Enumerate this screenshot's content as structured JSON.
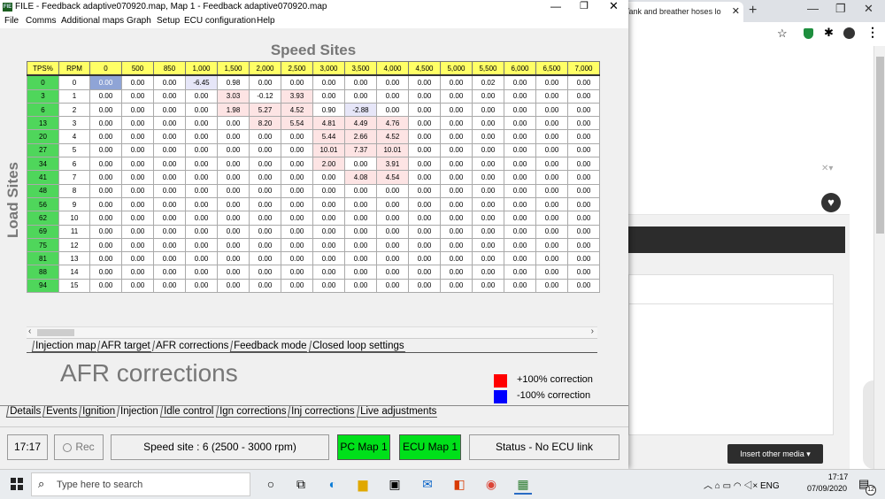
{
  "window": {
    "title": "FILE - Feedback adaptive070920.map,  Map 1 - Feedback adaptive070920.map",
    "icon_label": "FIE",
    "min": "—",
    "max": "❐",
    "close": "✕"
  },
  "menu": [
    "File",
    "Comms",
    "Additional maps",
    "Graph",
    "Setup",
    "ECU configuration",
    "Help"
  ],
  "grid": {
    "title": "Speed Sites",
    "side_title": "Load Sites",
    "header_tps": "TPS%",
    "header_rpm": "RPM",
    "columns": [
      "0",
      "500",
      "850",
      "1,000",
      "1,500",
      "2,000",
      "2,500",
      "3,000",
      "3,500",
      "4,000",
      "4,500",
      "5,000",
      "5,500",
      "6,000",
      "6,500",
      "7,000"
    ],
    "rows": [
      {
        "tps": "0",
        "idx": "0",
        "values": [
          "0.00",
          "0.00",
          "0.00",
          "-6.45",
          "0.98",
          "0.00",
          "0.00",
          "0.00",
          "0.00",
          "0.00",
          "0.00",
          "0.00",
          "0.02",
          "0.00",
          "0.00",
          "0.00"
        ]
      },
      {
        "tps": "3",
        "idx": "1",
        "values": [
          "0.00",
          "0.00",
          "0.00",
          "0.00",
          "3.03",
          "-0.12",
          "3.93",
          "0.00",
          "0.00",
          "0.00",
          "0.00",
          "0.00",
          "0.00",
          "0.00",
          "0.00",
          "0.00"
        ]
      },
      {
        "tps": "6",
        "idx": "2",
        "values": [
          "0.00",
          "0.00",
          "0.00",
          "0.00",
          "1.98",
          "5.27",
          "4.52",
          "0.90",
          "-2.88",
          "0.00",
          "0.00",
          "0.00",
          "0.00",
          "0.00",
          "0.00",
          "0.00"
        ]
      },
      {
        "tps": "13",
        "idx": "3",
        "values": [
          "0.00",
          "0.00",
          "0.00",
          "0.00",
          "0.00",
          "8.20",
          "5.54",
          "4.81",
          "4.49",
          "4.76",
          "0.00",
          "0.00",
          "0.00",
          "0.00",
          "0.00",
          "0.00"
        ]
      },
      {
        "tps": "20",
        "idx": "4",
        "values": [
          "0.00",
          "0.00",
          "0.00",
          "0.00",
          "0.00",
          "0.00",
          "0.00",
          "5.44",
          "2.66",
          "4.52",
          "0.00",
          "0.00",
          "0.00",
          "0.00",
          "0.00",
          "0.00"
        ]
      },
      {
        "tps": "27",
        "idx": "5",
        "values": [
          "0.00",
          "0.00",
          "0.00",
          "0.00",
          "0.00",
          "0.00",
          "0.00",
          "10.01",
          "7.37",
          "10.01",
          "0.00",
          "0.00",
          "0.00",
          "0.00",
          "0.00",
          "0.00"
        ]
      },
      {
        "tps": "34",
        "idx": "6",
        "values": [
          "0.00",
          "0.00",
          "0.00",
          "0.00",
          "0.00",
          "0.00",
          "0.00",
          "2.00",
          "0.00",
          "3.91",
          "0.00",
          "0.00",
          "0.00",
          "0.00",
          "0.00",
          "0.00"
        ]
      },
      {
        "tps": "41",
        "idx": "7",
        "values": [
          "0.00",
          "0.00",
          "0.00",
          "0.00",
          "0.00",
          "0.00",
          "0.00",
          "0.00",
          "4.08",
          "4.54",
          "0.00",
          "0.00",
          "0.00",
          "0.00",
          "0.00",
          "0.00"
        ]
      },
      {
        "tps": "48",
        "idx": "8",
        "values": [
          "0.00",
          "0.00",
          "0.00",
          "0.00",
          "0.00",
          "0.00",
          "0.00",
          "0.00",
          "0.00",
          "0.00",
          "0.00",
          "0.00",
          "0.00",
          "0.00",
          "0.00",
          "0.00"
        ]
      },
      {
        "tps": "56",
        "idx": "9",
        "values": [
          "0.00",
          "0.00",
          "0.00",
          "0.00",
          "0.00",
          "0.00",
          "0.00",
          "0.00",
          "0.00",
          "0.00",
          "0.00",
          "0.00",
          "0.00",
          "0.00",
          "0.00",
          "0.00"
        ]
      },
      {
        "tps": "62",
        "idx": "10",
        "values": [
          "0.00",
          "0.00",
          "0.00",
          "0.00",
          "0.00",
          "0.00",
          "0.00",
          "0.00",
          "0.00",
          "0.00",
          "0.00",
          "0.00",
          "0.00",
          "0.00",
          "0.00",
          "0.00"
        ]
      },
      {
        "tps": "69",
        "idx": "11",
        "values": [
          "0.00",
          "0.00",
          "0.00",
          "0.00",
          "0.00",
          "0.00",
          "0.00",
          "0.00",
          "0.00",
          "0.00",
          "0.00",
          "0.00",
          "0.00",
          "0.00",
          "0.00",
          "0.00"
        ]
      },
      {
        "tps": "75",
        "idx": "12",
        "values": [
          "0.00",
          "0.00",
          "0.00",
          "0.00",
          "0.00",
          "0.00",
          "0.00",
          "0.00",
          "0.00",
          "0.00",
          "0.00",
          "0.00",
          "0.00",
          "0.00",
          "0.00",
          "0.00"
        ]
      },
      {
        "tps": "81",
        "idx": "13",
        "values": [
          "0.00",
          "0.00",
          "0.00",
          "0.00",
          "0.00",
          "0.00",
          "0.00",
          "0.00",
          "0.00",
          "0.00",
          "0.00",
          "0.00",
          "0.00",
          "0.00",
          "0.00",
          "0.00"
        ]
      },
      {
        "tps": "88",
        "idx": "14",
        "values": [
          "0.00",
          "0.00",
          "0.00",
          "0.00",
          "0.00",
          "0.00",
          "0.00",
          "0.00",
          "0.00",
          "0.00",
          "0.00",
          "0.00",
          "0.00",
          "0.00",
          "0.00",
          "0.00"
        ]
      },
      {
        "tps": "94",
        "idx": "15",
        "values": [
          "0.00",
          "0.00",
          "0.00",
          "0.00",
          "0.00",
          "0.00",
          "0.00",
          "0.00",
          "0.00",
          "0.00",
          "0.00",
          "0.00",
          "0.00",
          "0.00",
          "0.00",
          "0.00"
        ]
      }
    ]
  },
  "tabs_top": [
    {
      "label": "Injection map",
      "active": false
    },
    {
      "label": "AFR target",
      "active": false
    },
    {
      "label": "AFR corrections",
      "active": true
    },
    {
      "label": "Feedback mode",
      "active": false
    },
    {
      "label": "Closed loop settings",
      "active": false
    }
  ],
  "heading": "AFR corrections",
  "legend": {
    "pos_label": "+100% correction",
    "neg_label": "-100% correction",
    "pos_color": "#ff0000",
    "neg_color": "#0000ff"
  },
  "tabs_bottom": [
    {
      "label": "Details",
      "active": false
    },
    {
      "label": "Events",
      "active": false
    },
    {
      "label": "Ignition",
      "active": false
    },
    {
      "label": "Injection",
      "active": true
    },
    {
      "label": "Idle control",
      "active": false
    },
    {
      "label": "Ign corrections",
      "active": false
    },
    {
      "label": "Inj corrections",
      "active": false
    },
    {
      "label": "Live adjustments",
      "active": false
    }
  ],
  "status": {
    "time": "17:17",
    "rec": "Rec",
    "speed_site": "Speed site : 6 (2500 - 3000 rpm)",
    "pc_map": "PC Map 1",
    "ecu_map": "ECU Map 1",
    "ecu_status": "Status - No ECU link",
    "map_color": "#00e01a"
  },
  "browser": {
    "tab_title": "Tank and breather hoses lo",
    "tab_close": "✕",
    "new_tab": "+",
    "toolbar_icons": [
      "star-icon",
      "shield-icon",
      "puzzle-icon",
      "account-icon",
      "more-icon"
    ],
    "insert_media": "Insert other media ▾"
  },
  "taskbar": {
    "search_placeholder": "Type here to search",
    "lang": "ENG",
    "time": "17:17",
    "date": "07/09/2020",
    "notifications": "12",
    "icons": [
      "cortana-icon",
      "task-view-icon",
      "edge-icon",
      "file-explorer-icon",
      "store-icon",
      "mail-icon",
      "office-icon",
      "chrome-icon",
      "app-icon"
    ]
  }
}
